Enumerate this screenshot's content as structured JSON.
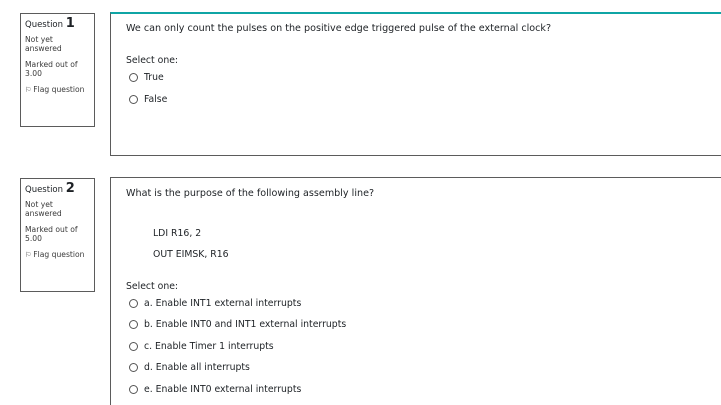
{
  "questions": [
    {
      "question_label": "Question",
      "number": "1",
      "status": "Not yet answered",
      "marks": "Marked out of 3.00",
      "flag_label": "Flag question",
      "text": "We can only count the pulses on the positive edge triggered pulse of the external clock?",
      "select_label": "Select one:",
      "options": [
        "True",
        "False"
      ]
    },
    {
      "question_label": "Question",
      "number": "2",
      "status": "Not yet answered",
      "marks": "Marked out of 5.00",
      "flag_label": "Flag question",
      "text": "What is the purpose of the following assembly line?",
      "code": [
        "LDI R16, 2",
        "OUT EIMSK, R16"
      ],
      "select_label": "Select one:",
      "options": [
        "a. Enable INT1 external interrupts",
        "b. Enable INT0 and INT1 external interrupts",
        "c. Enable Timer 1 interrupts",
        "d. Enable all interrupts",
        "e. Enable INT0 external interrupts"
      ]
    }
  ]
}
